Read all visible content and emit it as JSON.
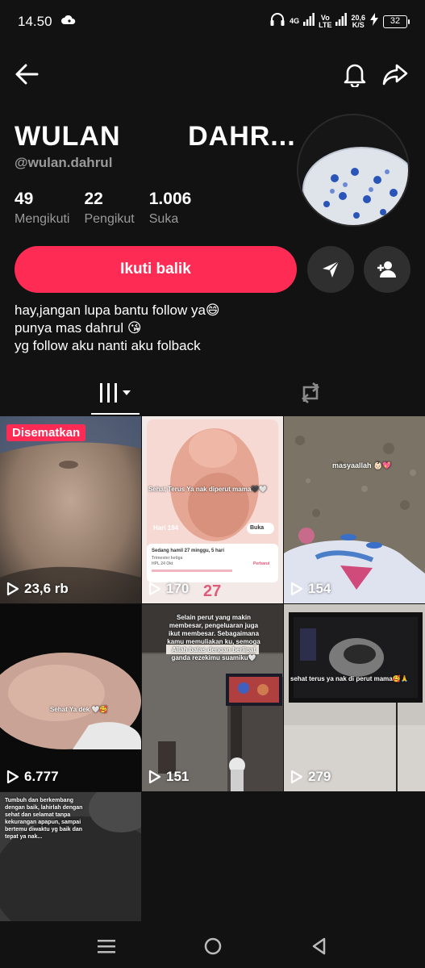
{
  "status_bar": {
    "time": "14.50",
    "network_4g": "4G",
    "network_volte_top": "Vo",
    "network_volte_bottom": "LTE",
    "speed_top": "20,6",
    "speed_bottom": "K/S",
    "battery": "32"
  },
  "profile": {
    "name": "WULAN        DAHR...",
    "handle": "@wulan.dahrul",
    "stats": [
      {
        "value": "49",
        "label": "Mengikuti"
      },
      {
        "value": "22",
        "label": "Pengikut"
      },
      {
        "value": "1.006",
        "label": "Suka"
      }
    ],
    "follow_back_label": "Ikuti balik",
    "bio": [
      "hay,jangan lupa bantu follow ya😄",
      "punya mas dahrul 😘",
      "yg follow aku nanti aku folback"
    ]
  },
  "videos": [
    {
      "views": "23,6 rb",
      "pinned_label": "Disematkan"
    },
    {
      "views": "170",
      "caption": "Sehat Terus Ya nak diperut mama🖤🤍",
      "app_day": "Hari 194",
      "app_btn": "Buka",
      "app_status": "Sedang hamil 27 minggu, 5 hari",
      "app_trimester": "Trimester ketiga",
      "app_hpl": "HPL 24 Okt",
      "app_link": "Perbarui",
      "app_big": "27"
    },
    {
      "views": "154",
      "caption": "masyaallah 👶🏻💖"
    },
    {
      "views": "6.777",
      "caption": "Sehat Ya dek 🤍🥰"
    },
    {
      "views": "151",
      "caption": "Selain perut yang makin membesar, pengeluaran juga ikut membesar. Sebagaimana kamu memuliakan ku, semoga Allah balas dengan berlipat ganda rezekimu suamiku🤍"
    },
    {
      "views": "279",
      "caption": "sehat terus ya nak di perut mama🥰🙏"
    },
    {
      "caption": "Tumbuh dan berkembang dengan baik, lahirlah dengan sehat dan selamat tanpa kekurangan apapun, sampai bertemu diwaktu yg baik dan tepat ya nak..."
    }
  ],
  "colors": {
    "accent": "#fe2c55",
    "background": "#121212",
    "secondary_text": "#9a9a9a",
    "round_button": "#2f2f2f"
  }
}
